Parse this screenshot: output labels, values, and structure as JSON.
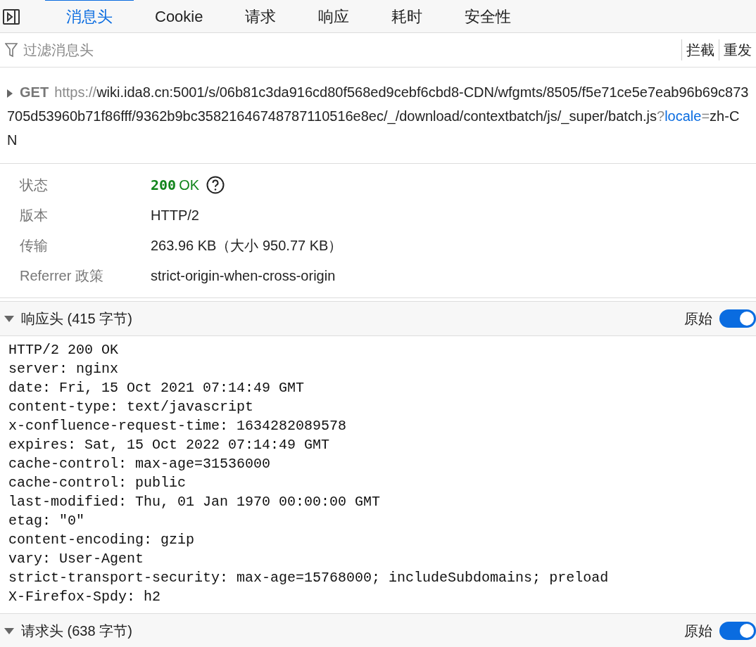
{
  "tabs": [
    {
      "label": "消息头",
      "selected": true
    },
    {
      "label": "Cookie",
      "selected": false
    },
    {
      "label": "请求",
      "selected": false
    },
    {
      "label": "响应",
      "selected": false
    },
    {
      "label": "耗时",
      "selected": false
    },
    {
      "label": "安全性",
      "selected": false
    }
  ],
  "filter": {
    "placeholder": "过滤消息头"
  },
  "toolbar_buttons": [
    "拦截",
    "重发"
  ],
  "request": {
    "method": "GET",
    "url_parts": [
      {
        "kind": "muted",
        "text": "https://"
      },
      {
        "kind": "plain",
        "text": "wiki.ida8.cn:5001/s/06b81c3da916cd80f568ed9cebf6cbd8-CDN/wfgmts/8505/f5e71ce5e7eab96b69c873705d53960b71f86fff/9362b9bc35821646748787110516e8ec/_/download/contextbatch/js/_super/batch.js"
      },
      {
        "kind": "muted",
        "text": "?"
      },
      {
        "kind": "param",
        "text": "locale"
      },
      {
        "kind": "muted",
        "text": "="
      },
      {
        "kind": "plain",
        "text": "zh-CN"
      }
    ]
  },
  "summary": [
    {
      "label": "状态",
      "kind": "status",
      "code": "200",
      "value": "OK"
    },
    {
      "label": "版本",
      "kind": "text",
      "value": "HTTP/2"
    },
    {
      "label": "传输",
      "kind": "text",
      "value": "263.96 KB（大小 950.77 KB）"
    },
    {
      "label": "Referrer 政策",
      "kind": "text",
      "value": "strict-origin-when-cross-origin"
    }
  ],
  "sections": [
    {
      "title": "响应头 (415 字节)",
      "expanded": true,
      "raw_label": "原始",
      "raw_on": true,
      "raw_lines": [
        "HTTP/2 200 OK",
        "server: nginx",
        "date: Fri, 15 Oct 2021 07:14:49 GMT",
        "content-type: text/javascript",
        "x-confluence-request-time: 1634282089578",
        "expires: Sat, 15 Oct 2022 07:14:49 GMT",
        "cache-control: max-age=31536000",
        "cache-control: public",
        "last-modified: Thu, 01 Jan 1970 00:00:00 GMT",
        "etag: \"0\"",
        "content-encoding: gzip",
        "vary: User-Agent",
        "strict-transport-security: max-age=15768000; includeSubdomains; preload",
        "X-Firefox-Spdy: h2"
      ]
    },
    {
      "title": "请求头 (638 字节)",
      "expanded": true,
      "raw_label": "原始",
      "raw_on": true
    }
  ]
}
